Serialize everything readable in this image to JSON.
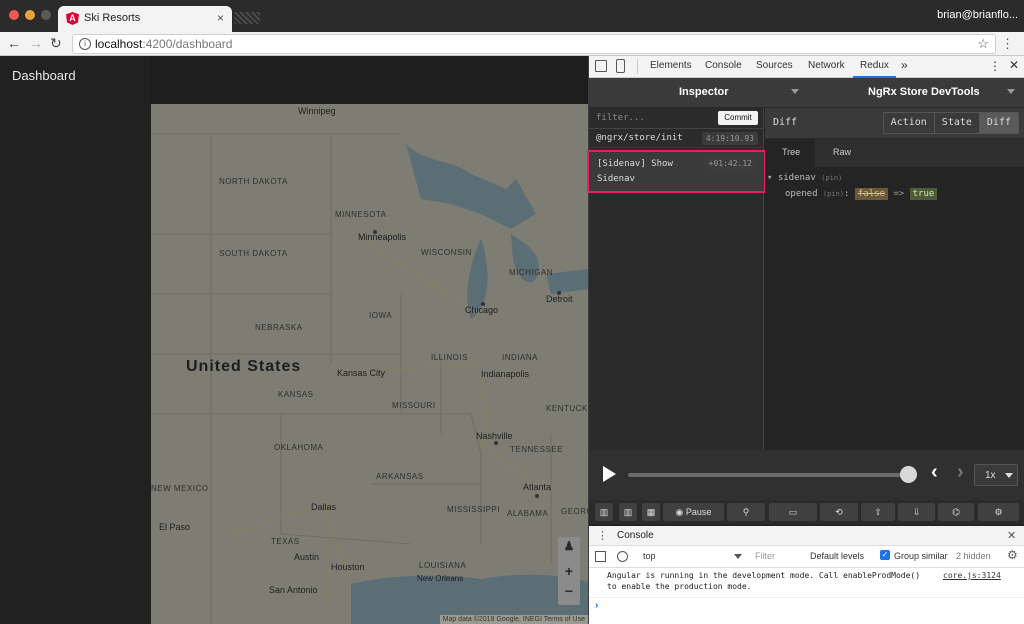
{
  "browser": {
    "tab_title": "Ski Resorts",
    "tab_close": "×",
    "user": "brian@brianflo...",
    "url_host": "localhost",
    "url_rest": ":4200/dashboard"
  },
  "app": {
    "sidenav_title": "Dashboard"
  },
  "map": {
    "country_label": "United States",
    "region_labels": [
      "NORTH DAKOTA",
      "SOUTH DAKOTA",
      "MINNESOTA",
      "WISCONSIN",
      "MICHIGAN",
      "IOWA",
      "NEBRASKA",
      "ILLINOIS",
      "INDIANA",
      "KANSAS",
      "MISSOURI",
      "KENTUCKY",
      "TENNESSEE",
      "OKLAHOMA",
      "ARKANSAS",
      "MISSISSIPPI",
      "ALABAMA",
      "GEORGIA",
      "NEW MEXICO",
      "TEXAS",
      "LOUISIANA"
    ],
    "cities": [
      "Winnipeg",
      "Minneapolis",
      "Chicago",
      "Detroit",
      "Kansas City",
      "Indianapolis",
      "Nashville",
      "Atlanta",
      "Dallas",
      "El Paso",
      "Austin",
      "Houston",
      "San Antonio",
      "New Orleans"
    ],
    "zoom_in": "+",
    "zoom_out": "−",
    "attribution": "Map data ©2018 Google, INEGI   Terms of Use"
  },
  "devtools": {
    "tabs": [
      "Elements",
      "Console",
      "Sources",
      "Network",
      "Redux"
    ],
    "more": "»",
    "redux": {
      "left_select": "Inspector",
      "right_select": "NgRx Store DevTools",
      "filter_placeholder": "filter...",
      "commit_label": "Commit",
      "actions": [
        {
          "name": "@ngrx/store/init",
          "time": "4:19:10.93"
        },
        {
          "name": "[Sidenav] Show Sidenav",
          "time": "+01:42.12"
        }
      ],
      "inspector_label": "Diff",
      "modes": [
        "Action",
        "State",
        "Diff"
      ],
      "active_mode": "Diff",
      "subtabs": [
        "Tree",
        "Raw"
      ],
      "tree": {
        "root_key": "sidenav",
        "pin": "(pin)",
        "child_key": "opened",
        "old_value": "false",
        "arrow": "=>",
        "new_value": "true"
      },
      "speed": "1x",
      "toolbar": {
        "pause_label": "Pause"
      }
    },
    "console": {
      "title": "Console",
      "context": "top",
      "filter_placeholder": "Filter",
      "levels": "Default levels",
      "group_similar": "Group similar",
      "hidden": "2 hidden",
      "message_line1": "Angular is running in the development mode. Call enableProdMode()",
      "message_line2": "to enable the production mode.",
      "source": "core.js:3124",
      "prompt": "›"
    }
  },
  "colors": {
    "highlight": "#e91e63",
    "sidenav": "#212121",
    "map_overlay": "#7d7d74"
  }
}
